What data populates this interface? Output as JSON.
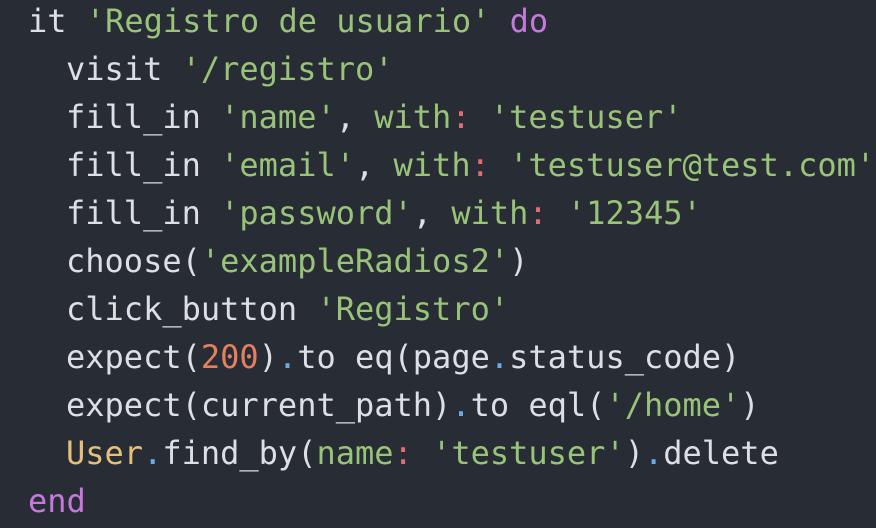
{
  "code": {
    "line1": {
      "kw_it": "it",
      "str": "'Registro de usuario'",
      "kw_do": "do"
    },
    "line2": {
      "method": "visit",
      "str": "'/registro'"
    },
    "line3": {
      "method": "fill_in",
      "str1": "'name'",
      "comma": ",",
      "with": "with",
      "colon": ":",
      "str2": "'testuser'"
    },
    "line4": {
      "method": "fill_in",
      "str1": "'email'",
      "comma": ",",
      "with": "with",
      "colon": ":",
      "str2": "'testuser@test.com'"
    },
    "line5": {
      "method": "fill_in",
      "str1": "'password'",
      "comma": ",",
      "with": "with",
      "colon": ":",
      "str2": "'12345'"
    },
    "line6": {
      "method": "choose",
      "open": "(",
      "str": "'exampleRadios2'",
      "close": ")"
    },
    "line7": {
      "method": "click_button",
      "str": "'Registro'"
    },
    "line8": {
      "method": "expect",
      "open": "(",
      "num": "200",
      "close": ")",
      "dot": ".",
      "to": "to eq",
      "open2": "(page",
      "dot2": ".",
      "rest": "status_code)"
    },
    "line9": {
      "method": "expect",
      "open": "(current_path)",
      "dot": ".",
      "to": "to eql",
      "open2": "(",
      "str": "'/home'",
      "close": ")"
    },
    "line10": {
      "const": "User",
      "dot": ".",
      "method": "find_by(",
      "sym": "name",
      "colon": ":",
      "str": "'testuser'",
      "close": ")",
      "dot2": ".",
      "rest": "delete"
    },
    "line11": {
      "kw_end": "end"
    }
  },
  "colors": {
    "background": "#282c34",
    "keyword": "#c678dd",
    "string": "#98c379",
    "number": "#e5805f",
    "constant": "#e5c07b",
    "plain": "#dcdfe4"
  }
}
